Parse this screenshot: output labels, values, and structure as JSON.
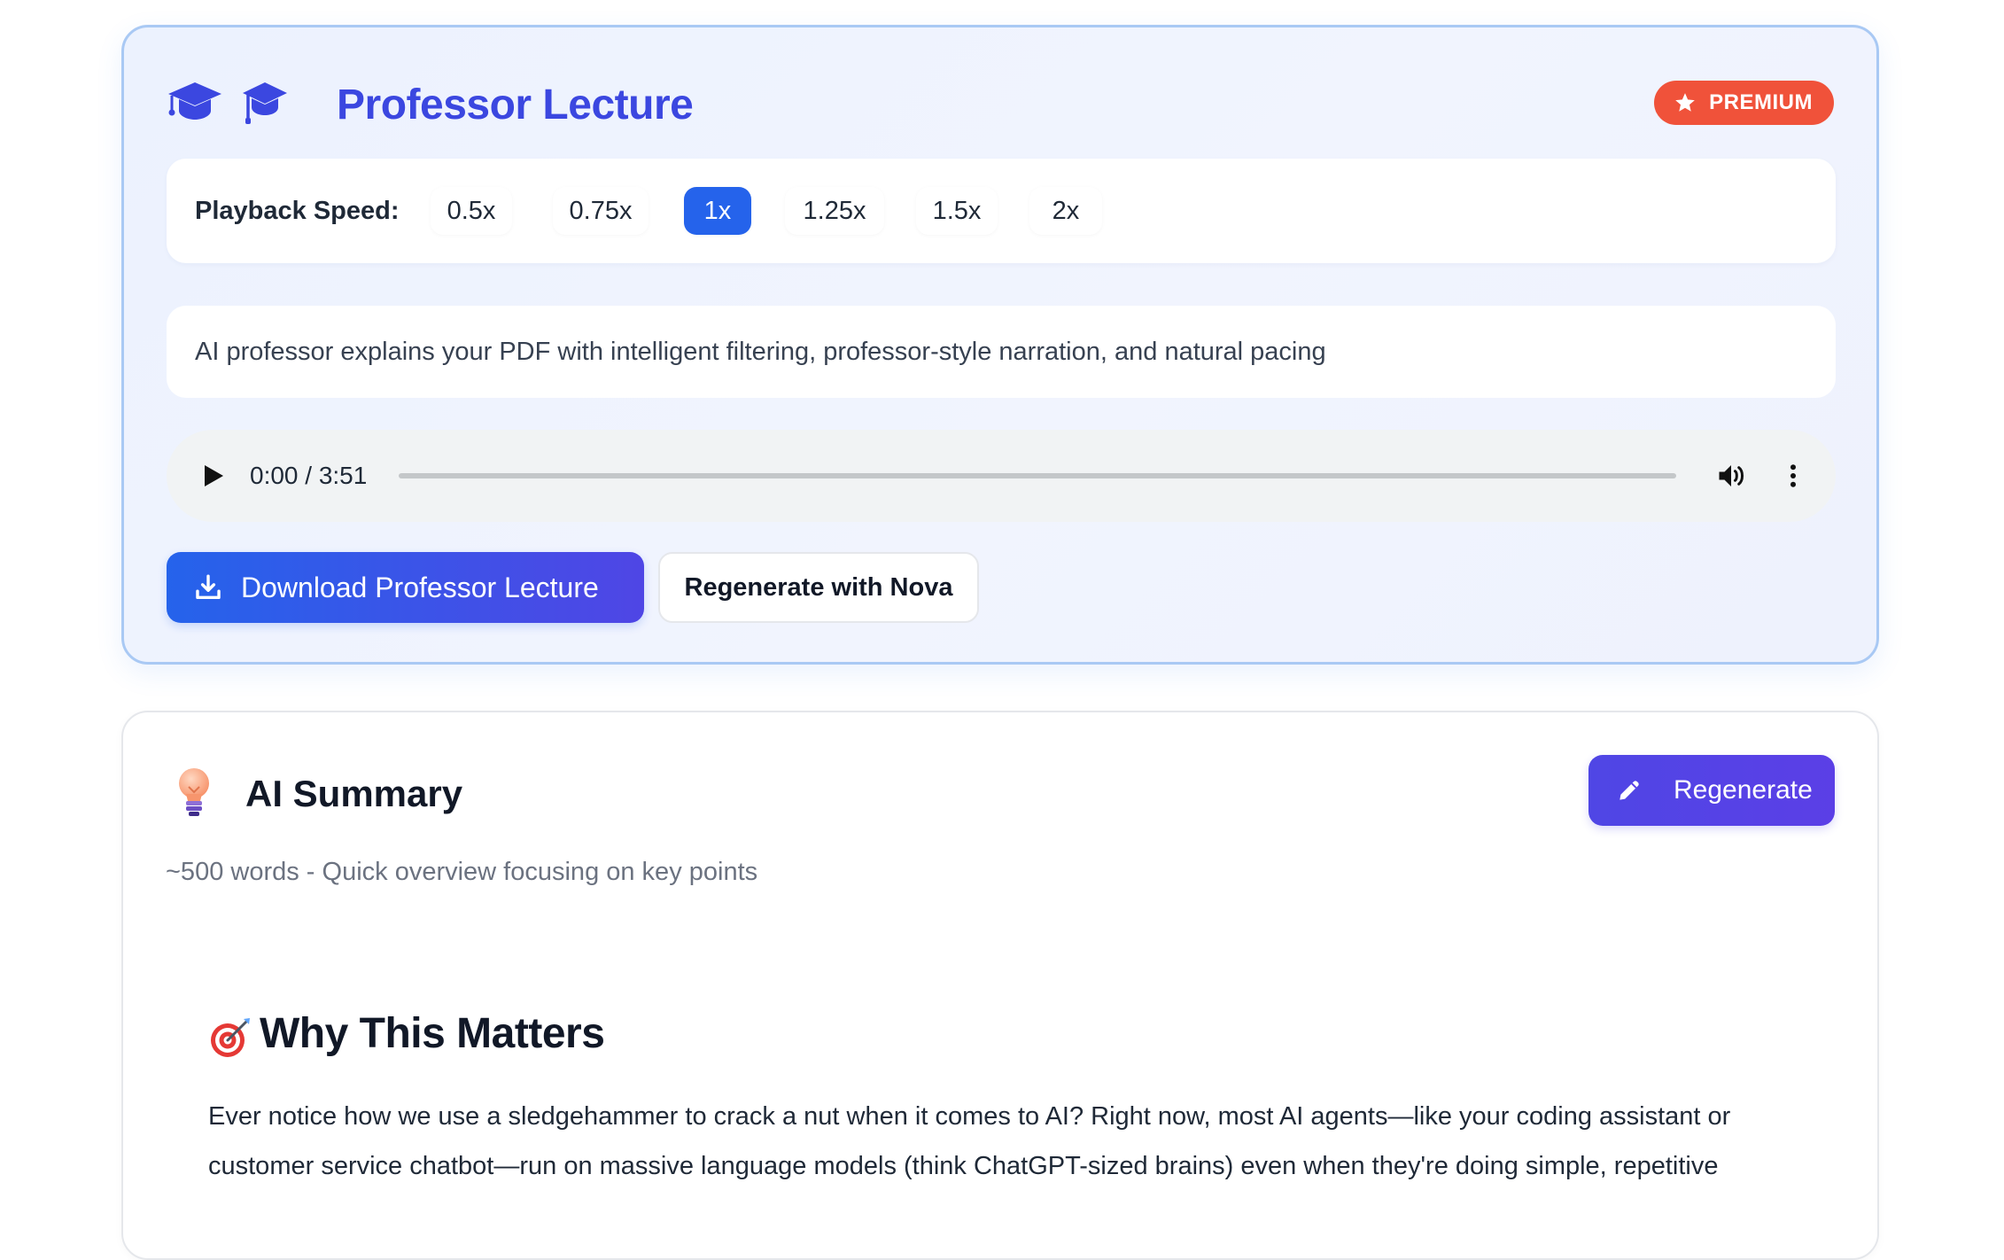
{
  "lecture": {
    "title": "Professor Lecture",
    "badge": "PREMIUM",
    "speed": {
      "label": "Playback Speed:",
      "options": [
        "0.5x",
        "0.75x",
        "1x",
        "1.25x",
        "1.5x",
        "2x"
      ],
      "selected": "1x"
    },
    "description": "AI professor explains your PDF with intelligent filtering, professor-style narration, and natural pacing",
    "audio": {
      "time": "0:00 / 3:51",
      "progress": 0
    },
    "download_label": "Download Professor Lecture",
    "regenerate_nova_label": "Regenerate with Nova"
  },
  "summary": {
    "title": "AI Summary",
    "regenerate_label": "Regenerate",
    "subtitle": "~500 words - Quick overview focusing on key points",
    "section_heading": "Why This Matters",
    "body": "Ever notice how we use a sledgehammer to crack a nut when it comes to AI? Right now, most AI agents—like your coding assistant or customer service chatbot—run on massive language models (think ChatGPT-sized brains) even when they're doing simple, repetitive"
  },
  "icons": {
    "header_icon_1": "graduation-cap-icon",
    "header_icon_2": "graduation-cap-icon",
    "badge_icon": "star-icon",
    "download_icon": "download-icon",
    "regenerate_icon": "pencil-icon",
    "summary_icon": "lightbulb-icon",
    "section_icon": "target-icon"
  },
  "colors": {
    "title_accent": "#3b47e0",
    "premium_badge": "#f0523a",
    "speed_active": "#2563eb",
    "download_button": "#2563eb",
    "regenerate_button": "#4f46e5"
  }
}
